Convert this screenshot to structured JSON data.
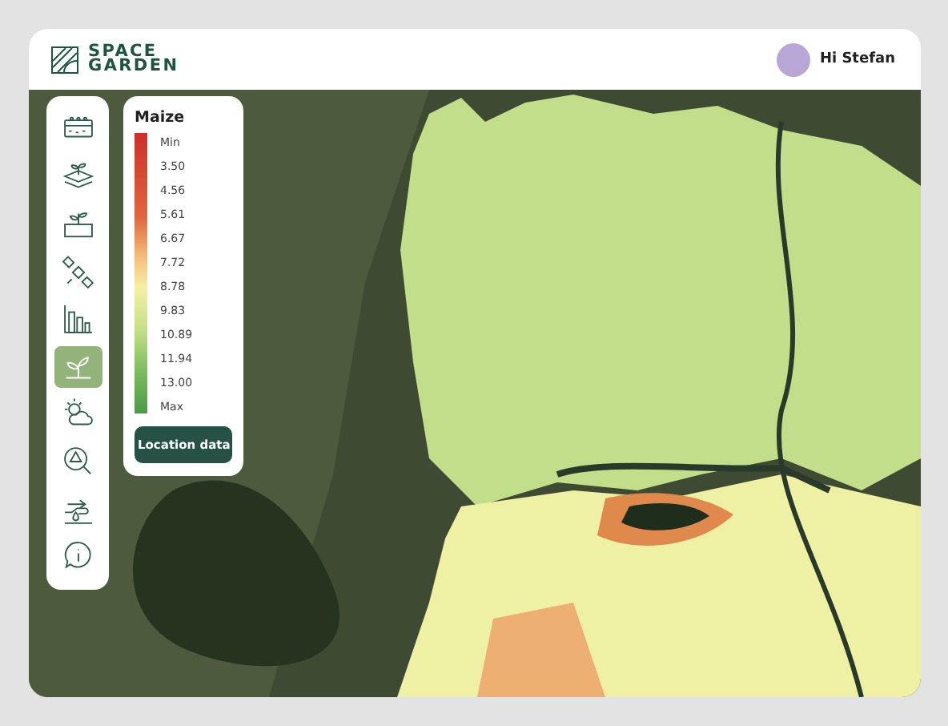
{
  "header": {
    "logo": [
      "SPACE",
      "GARDEN"
    ],
    "greeting": "Hi Stefan"
  },
  "sidebar": {
    "items": [
      {
        "selected": false
      },
      {
        "selected": false
      },
      {
        "selected": false
      },
      {
        "selected": false
      },
      {
        "selected": false
      },
      {
        "selected": true
      },
      {
        "selected": false
      },
      {
        "selected": false
      },
      {
        "selected": false
      },
      {
        "selected": false
      }
    ]
  },
  "legend": {
    "title": "Maize",
    "labels": [
      "Min",
      "3.50",
      "4.56",
      "5.61",
      "6.67",
      "7.72",
      "8.78",
      "9.83",
      "10.89",
      "11.94",
      "13.00",
      "Max"
    ],
    "button": "Location data"
  }
}
